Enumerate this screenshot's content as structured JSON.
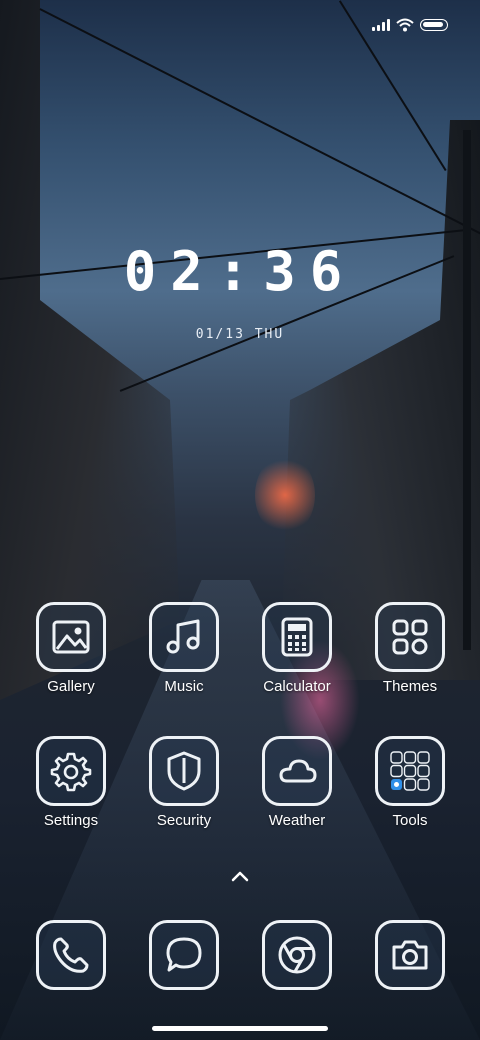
{
  "status_bar": {
    "signal_icon": "signal-bars-icon",
    "wifi_icon": "wifi-icon",
    "battery_icon": "battery-icon"
  },
  "clock": {
    "time": "02:36",
    "date": "01/13 THU"
  },
  "apps_row1": [
    {
      "label": "Gallery",
      "icon": "gallery-icon"
    },
    {
      "label": "Music",
      "icon": "music-icon"
    },
    {
      "label": "Calculator",
      "icon": "calculator-icon"
    },
    {
      "label": "Themes",
      "icon": "themes-icon"
    }
  ],
  "apps_row2": [
    {
      "label": "Settings",
      "icon": "gear-icon"
    },
    {
      "label": "Security",
      "icon": "shield-icon"
    },
    {
      "label": "Weather",
      "icon": "cloud-icon"
    },
    {
      "label": "Tools",
      "icon": "tools-folder-icon"
    }
  ],
  "dock": [
    {
      "icon": "phone-icon"
    },
    {
      "icon": "message-icon"
    },
    {
      "icon": "browser-icon"
    },
    {
      "icon": "camera-icon"
    }
  ],
  "colors": {
    "icon_stroke": "#eef2f6",
    "text": "#ffffff"
  }
}
